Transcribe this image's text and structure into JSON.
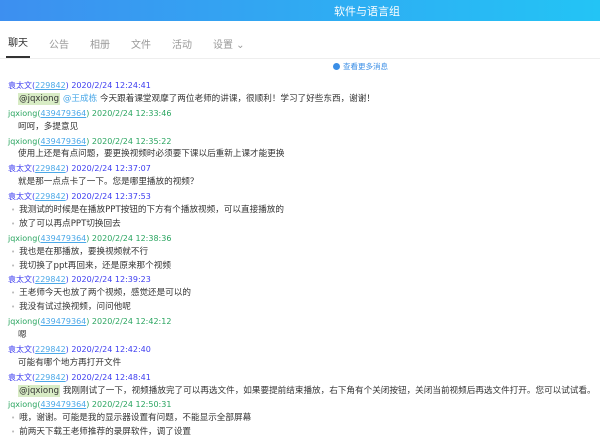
{
  "header": {
    "title": "软件与语言组"
  },
  "tabs": [
    {
      "label": "聊天",
      "active": true
    },
    {
      "label": "公告"
    },
    {
      "label": "相册"
    },
    {
      "label": "文件"
    },
    {
      "label": "活动"
    },
    {
      "label": "设置 ⌄"
    }
  ],
  "more_messages": "查看更多消息",
  "messages": [
    {
      "sender": "袁太文",
      "id": "229842",
      "time": "2020/2/24 12:24:41",
      "color": "b",
      "bullets": false,
      "mention": "@jqxiong",
      "at": "@王成栋",
      "lines": [
        "今天跟着课堂观摩了两位老师的讲课，很顺利！学习了好些东西，谢谢！"
      ]
    },
    {
      "sender": "jqxiong",
      "id": "439479364",
      "time": "2020/2/24 12:33:46",
      "color": "g",
      "bullets": false,
      "lines": [
        "呵呵，多提意见"
      ]
    },
    {
      "sender": "jqxiong",
      "id": "439479364",
      "time": "2020/2/24 12:35:22",
      "color": "g",
      "bullets": false,
      "lines": [
        "使用上还是有点问题，要更换视频时必须要下课以后重新上课才能更换"
      ]
    },
    {
      "sender": "袁太文",
      "id": "229842",
      "time": "2020/2/24 12:37:07",
      "color": "b",
      "bullets": false,
      "lines": [
        "就是那一点点卡了一下。您是哪里播放的视频？"
      ]
    },
    {
      "sender": "袁太文",
      "id": "229842",
      "time": "2020/2/24 12:37:53",
      "color": "b",
      "bullets": true,
      "lines": [
        "我测试的时候是在播放PPT按钮的下方有个播放视频，可以直接播放的",
        "放了可以再点PPT切换回去"
      ]
    },
    {
      "sender": "jqxiong",
      "id": "439479364",
      "time": "2020/2/24 12:38:36",
      "color": "g",
      "bullets": true,
      "lines": [
        "我也是在那播放，要换视频就不行",
        "我切换了ppt再回来，还是原来那个视频"
      ]
    },
    {
      "sender": "袁太文",
      "id": "229842",
      "time": "2020/2/24 12:39:23",
      "color": "b",
      "bullets": true,
      "lines": [
        "王老师今天也放了两个视频，感觉还是可以的",
        "我没有试过换视频，问问他呢"
      ]
    },
    {
      "sender": "jqxiong",
      "id": "439479364",
      "time": "2020/2/24 12:42:12",
      "color": "g",
      "bullets": false,
      "lines": [
        "嗯"
      ]
    },
    {
      "sender": "袁太文",
      "id": "229842",
      "time": "2020/2/24 12:42:40",
      "color": "b",
      "bullets": false,
      "lines": [
        "可能有哪个地方再打开文件"
      ]
    },
    {
      "sender": "袁太文",
      "id": "229842",
      "time": "2020/2/24 12:48:41",
      "color": "b",
      "bullets": false,
      "mention": "@jqxiong",
      "lines": [
        "我刚刚试了一下，视频播放完了可以再选文件，如果要提前结束播放，右下角有个关闭按钮，关闭当前视频后再选文件打开。您可以试试看。"
      ]
    },
    {
      "sender": "jqxiong",
      "id": "439479364",
      "time": "2020/2/24 12:50:31",
      "color": "g",
      "bullets": true,
      "lines": [
        "哦，谢谢。可能是我的显示器设置有问题，不能显示全部屏幕",
        "前两天下载王老师推荐的录屏软件，调了设置"
      ]
    }
  ]
}
